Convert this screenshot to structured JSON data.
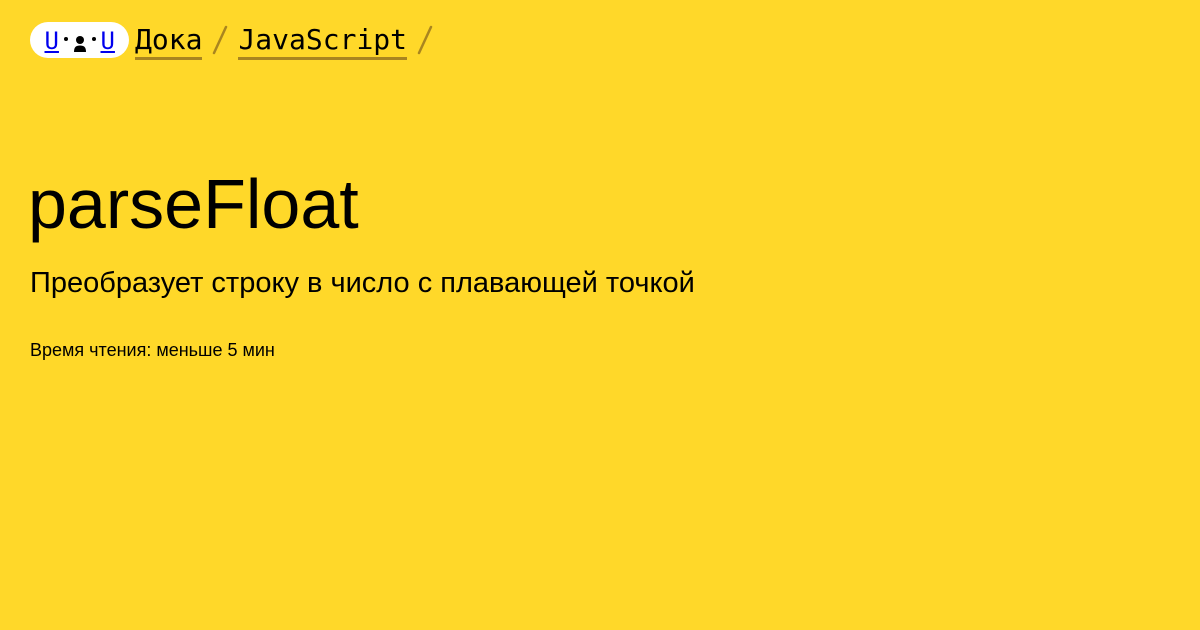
{
  "colors": {
    "background": "#FFD829",
    "logo_background": "#FFFFFF",
    "underline": "#A9851F",
    "separator": "#A9851F",
    "text": "#000000"
  },
  "logo": {
    "left_glyph": "U",
    "right_glyph": "U",
    "icon": "doka-face-logo"
  },
  "breadcrumb": {
    "items": [
      {
        "label": "Дока"
      },
      {
        "label": "JavaScript"
      }
    ],
    "separator_icon": "slash-separator-icon"
  },
  "article": {
    "title": "parseFloat",
    "description": "Преобразует строку в число с плавающей точкой",
    "reading_time": "Время чтения: меньше 5 мин"
  }
}
